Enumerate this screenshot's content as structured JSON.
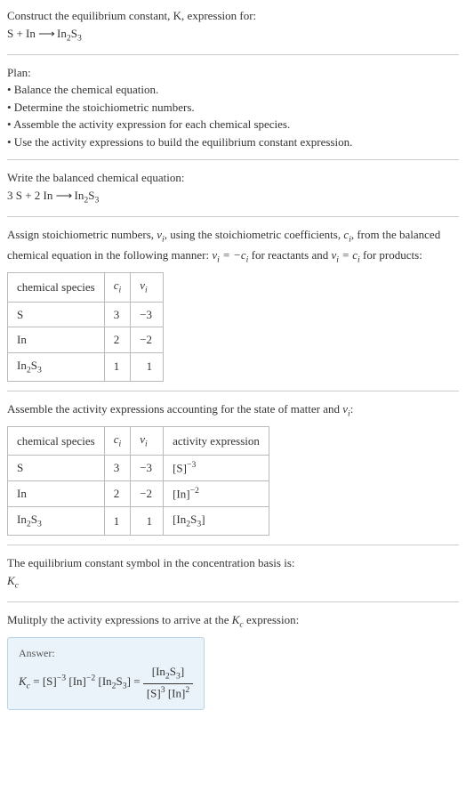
{
  "intro": {
    "line1": "Construct the equilibrium constant, K, expression for:",
    "reaction": "S + In ⟶ In₂S₃"
  },
  "plan": {
    "title": "Plan:",
    "b1": "• Balance the chemical equation.",
    "b2": "• Determine the stoichiometric numbers.",
    "b3": "• Assemble the activity expression for each chemical species.",
    "b4": "• Use the activity expressions to build the equilibrium constant expression."
  },
  "balanced": {
    "title": "Write the balanced chemical equation:",
    "reaction": "3 S + 2 In ⟶ In₂S₃"
  },
  "stoich": {
    "text_pre": "Assign stoichiometric numbers, ",
    "nu": "νᵢ",
    "text_mid1": ", using the stoichiometric coefficients, ",
    "ci": "cᵢ",
    "text_mid2": ", from the balanced chemical equation in the following manner: ",
    "relation1": "νᵢ = −cᵢ",
    "text_mid3": " for reactants and ",
    "relation2": "νᵢ = cᵢ",
    "text_mid4": " for products:",
    "headers": {
      "h1": "chemical species",
      "h2": "cᵢ",
      "h3": "νᵢ"
    },
    "rows": [
      {
        "species": "S",
        "ci": "3",
        "nu": "−3"
      },
      {
        "species": "In",
        "ci": "2",
        "nu": "−2"
      },
      {
        "species": "In₂S₃",
        "ci": "1",
        "nu": "1"
      }
    ]
  },
  "activity": {
    "text_pre": "Assemble the activity expressions accounting for the state of matter and ",
    "nu": "νᵢ",
    "text_post": ":",
    "headers": {
      "h1": "chemical species",
      "h2": "cᵢ",
      "h3": "νᵢ",
      "h4": "activity expression"
    },
    "rows": [
      {
        "species": "S",
        "ci": "3",
        "nu": "−3",
        "expr": "[S]⁻³"
      },
      {
        "species": "In",
        "ci": "2",
        "nu": "−2",
        "expr": "[In]⁻²"
      },
      {
        "species": "In₂S₃",
        "ci": "1",
        "nu": "1",
        "expr": "[In₂S₃]"
      }
    ]
  },
  "symbol": {
    "text": "The equilibrium constant symbol in the concentration basis is:",
    "kc": "K𝒸"
  },
  "multiply": {
    "text_pre": "Mulitply the activity expressions to arrive at the ",
    "kc": "K𝒸",
    "text_post": " expression:"
  },
  "answer": {
    "label": "Answer:",
    "lhs": "K𝒸 = [S]⁻³ [In]⁻² [In₂S₃] = ",
    "num": "[In₂S₃]",
    "den": "[S]³ [In]²"
  },
  "chart_data": {
    "type": "table",
    "tables": [
      {
        "title": "Stoichiometric numbers",
        "columns": [
          "chemical species",
          "cᵢ",
          "νᵢ"
        ],
        "rows": [
          [
            "S",
            3,
            -3
          ],
          [
            "In",
            2,
            -2
          ],
          [
            "In₂S₃",
            1,
            1
          ]
        ]
      },
      {
        "title": "Activity expressions",
        "columns": [
          "chemical species",
          "cᵢ",
          "νᵢ",
          "activity expression"
        ],
        "rows": [
          [
            "S",
            3,
            -3,
            "[S]^-3"
          ],
          [
            "In",
            2,
            -2,
            "[In]^-2"
          ],
          [
            "In₂S₃",
            1,
            1,
            "[In₂S₃]"
          ]
        ]
      }
    ],
    "balanced_equation": "3 S + 2 In ⟶ In₂S₃",
    "equilibrium_constant": "Kc = [In₂S₃] / ([S]^3 [In]^2)"
  }
}
